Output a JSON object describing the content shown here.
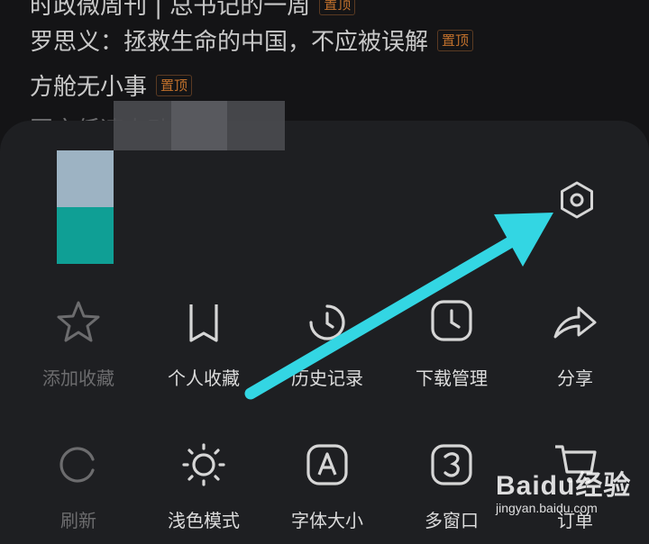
{
  "news": {
    "items": [
      {
        "title": "时政微周刊 | 总书记的一周",
        "tag": "置顶"
      },
      {
        "title": "罗思义：拯救生命的中国，不应被误解",
        "tag": "置顶"
      },
      {
        "title": "方舱无小事",
        "tag": "置顶"
      },
      {
        "title": "国产低速电动",
        "tag": ""
      }
    ]
  },
  "menu": {
    "row1": [
      {
        "label": "添加收藏",
        "icon": "star-icon",
        "enabled": false
      },
      {
        "label": "个人收藏",
        "icon": "bookmark-icon",
        "enabled": true
      },
      {
        "label": "历史记录",
        "icon": "clock-icon",
        "enabled": true
      },
      {
        "label": "下载管理",
        "icon": "download-clock-icon",
        "enabled": true
      },
      {
        "label": "分享",
        "icon": "share-icon",
        "enabled": true
      }
    ],
    "row2": [
      {
        "label": "刷新",
        "icon": "refresh-icon",
        "enabled": false
      },
      {
        "label": "浅色模式",
        "icon": "sun-icon",
        "enabled": true
      },
      {
        "label": "字体大小",
        "icon": "font-size-icon",
        "enabled": true
      },
      {
        "label": "多窗口",
        "icon": "multi-window-icon",
        "enabled": true
      },
      {
        "label": "订单",
        "icon": "cart-icon",
        "enabled": true
      }
    ]
  },
  "settings": {
    "icon": "settings-hexagon-icon"
  },
  "watermark": {
    "logo": "Baidu经验",
    "url": "jingyan.baidu.com"
  },
  "colors": {
    "accent_arrow": "#33d6e3",
    "tag": "#c0702c",
    "avatar_teal": "#0f9f95",
    "avatar_light": "#9db3c3"
  }
}
